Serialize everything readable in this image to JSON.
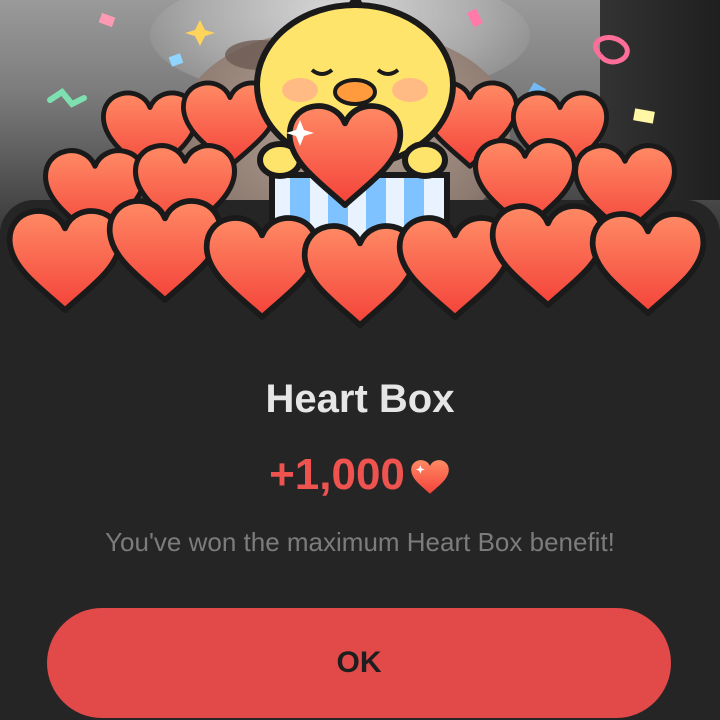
{
  "dialog": {
    "title": "Heart Box",
    "reward_amount": "+1,000",
    "reward_icon": "heart-icon",
    "message": "You've won the maximum Heart Box benefit!",
    "ok_label": "OK"
  },
  "colors": {
    "accent": "#e24a4a",
    "reward_text": "#ef5350",
    "sheet_background": "#252525",
    "title_text": "#e6e6e6",
    "message_text": "#7c7c7c"
  }
}
